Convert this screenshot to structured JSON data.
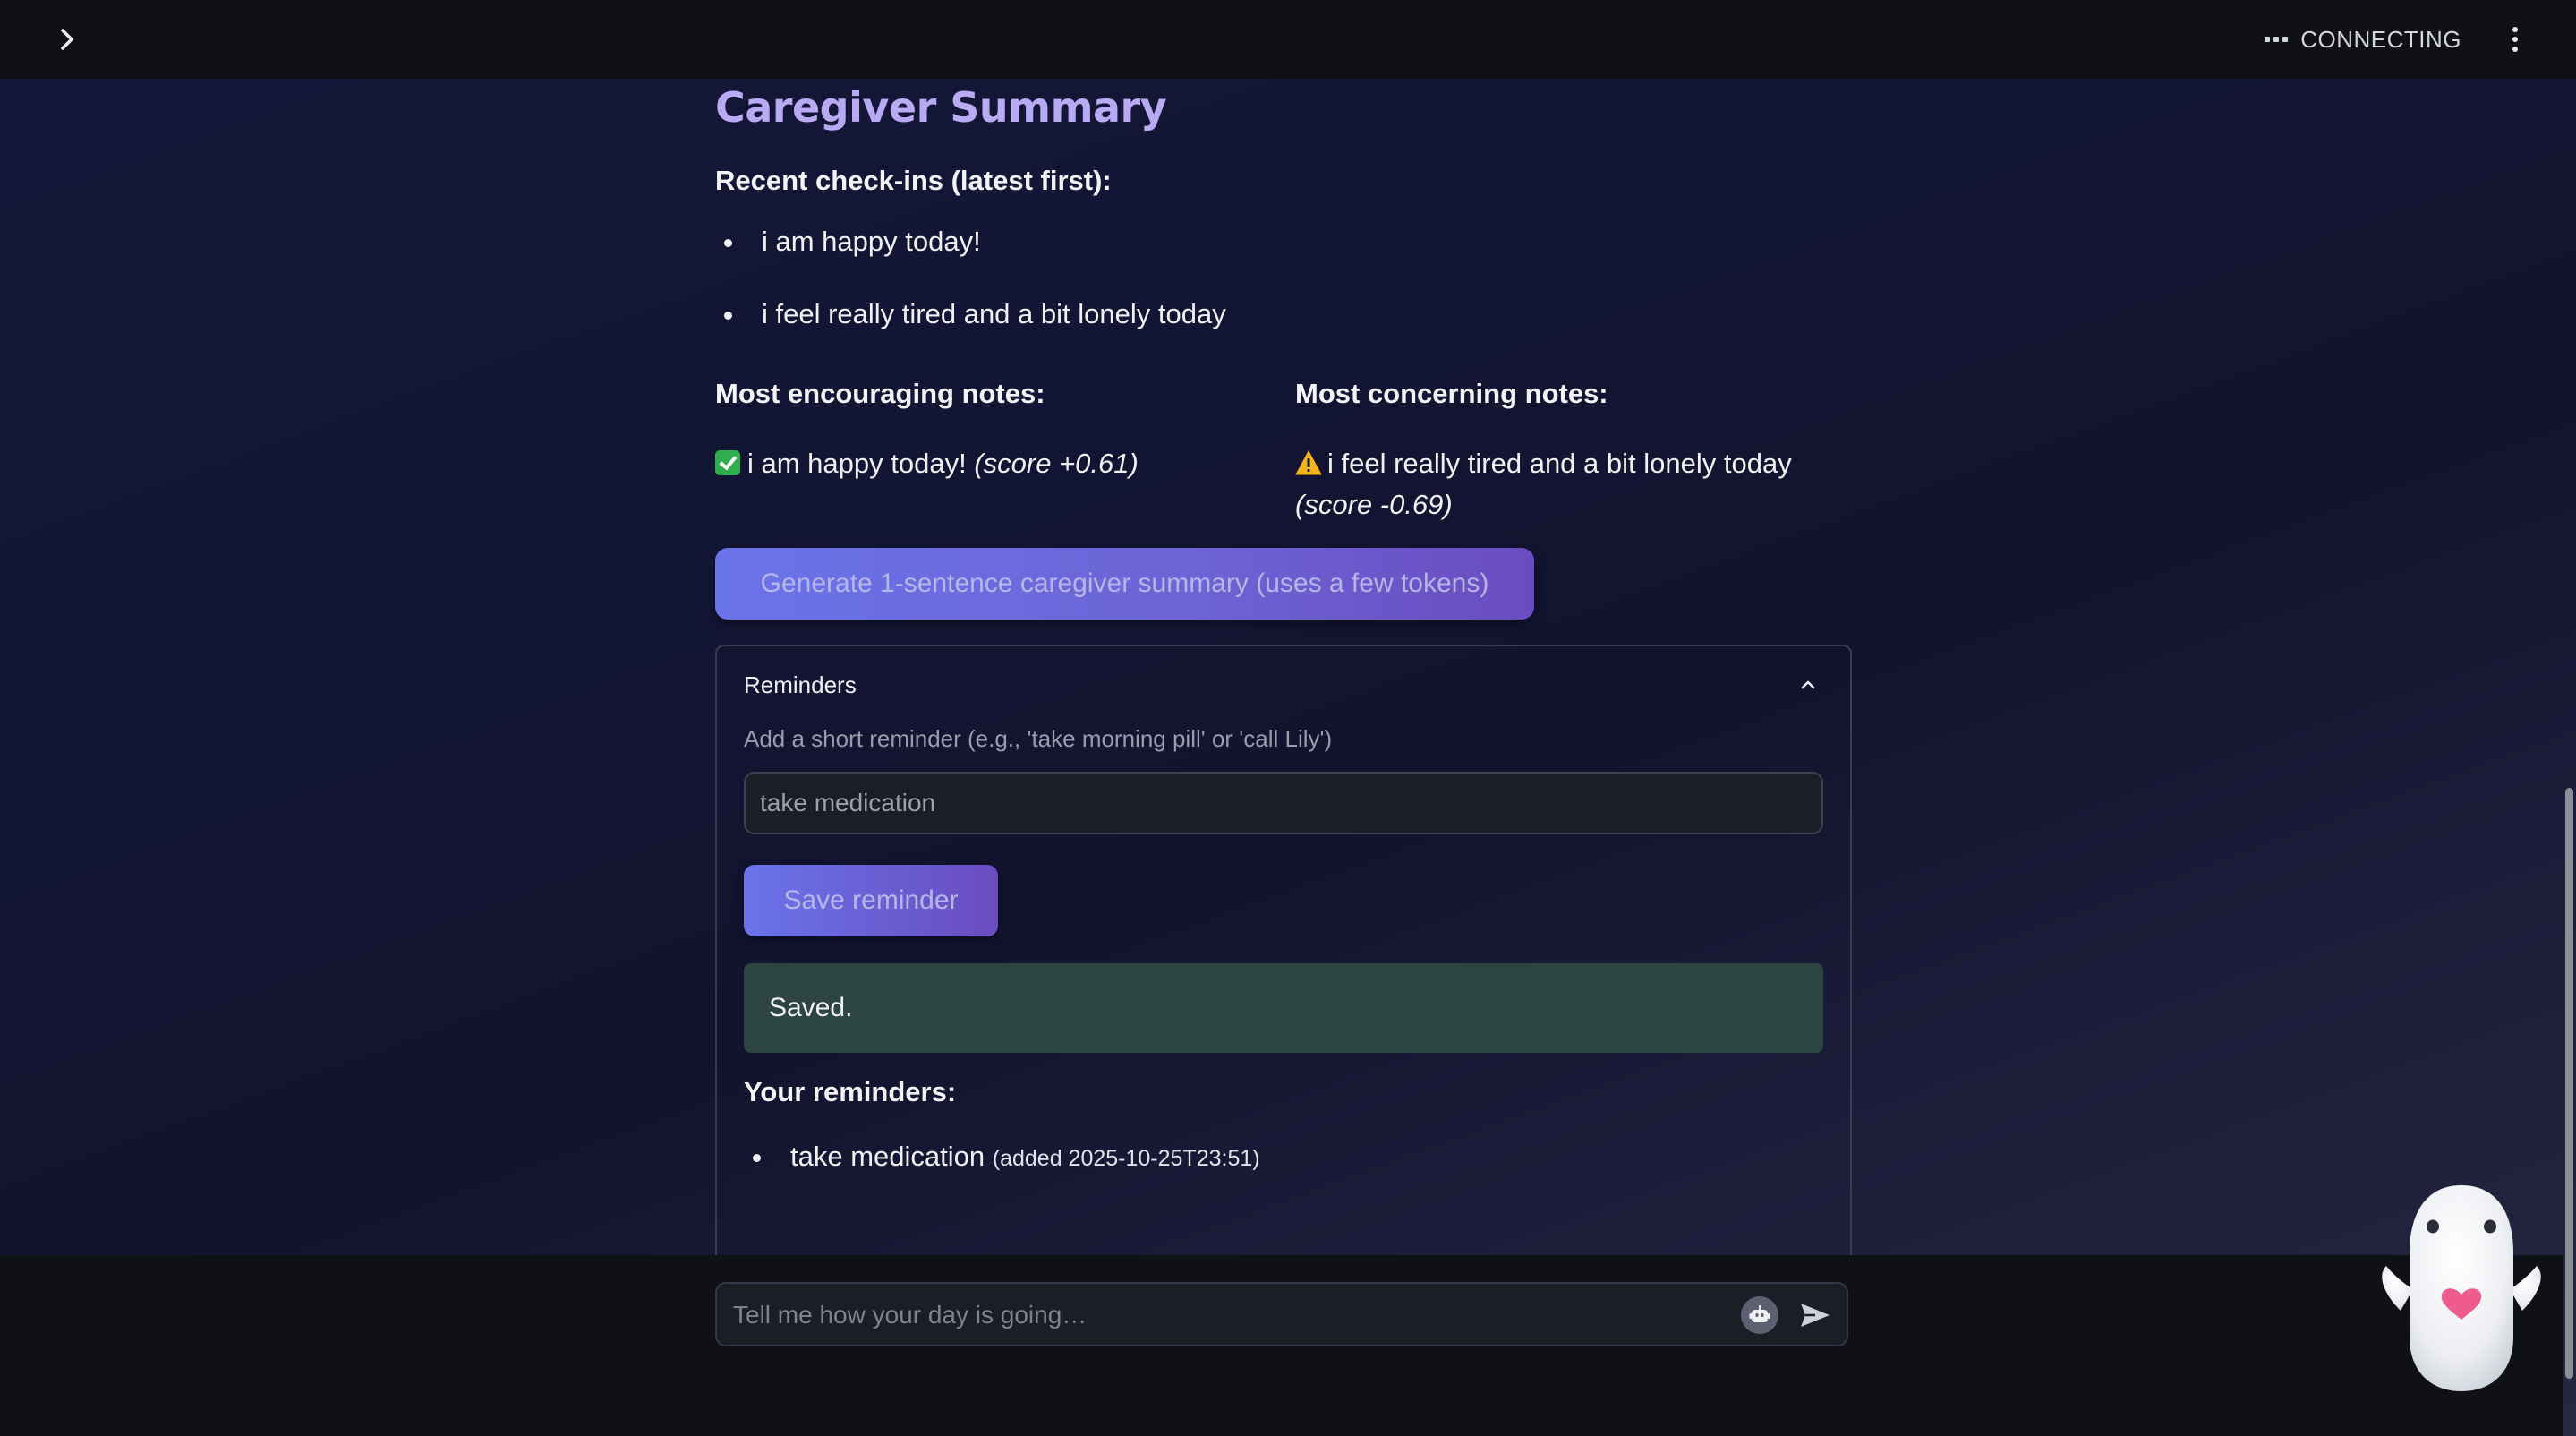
{
  "header": {
    "status": "CONNECTING"
  },
  "summary": {
    "title": "Caregiver Summary",
    "recent_heading": "Recent check-ins (latest first):",
    "recent_checkins": [
      "i am happy today!",
      "i feel really tired and a bit lonely today"
    ],
    "encouraging_heading": "Most encouraging notes:",
    "encouraging_text": "i am happy today!",
    "encouraging_score": "(score +0.61)",
    "concerning_heading": "Most concerning notes:",
    "concerning_text": "i feel really tired and a bit lonely today",
    "concerning_score": "(score -0.69)",
    "generate_button": "Generate 1-sentence caregiver summary (uses a few tokens)"
  },
  "reminders": {
    "header": "Reminders",
    "input_label": "Add a short reminder (e.g., 'take morning pill' or 'call Lily')",
    "input_value": "take medication",
    "save_button": "Save reminder",
    "saved_message": "Saved.",
    "list_heading": "Your reminders:",
    "items": [
      {
        "text": "take medication",
        "added": "(added 2025-10-25T23:51)"
      }
    ]
  },
  "chat": {
    "placeholder": "Tell me how your day is going…"
  },
  "icons": {
    "sidebar_toggle": "chevron-right-icon",
    "status": "ellipsis-icon",
    "menu": "kebab-menu-icon",
    "collapse": "chevron-up-icon",
    "bot": "robot-icon",
    "send": "send-icon",
    "mascot": "ghost-mascot-icon"
  },
  "colors": {
    "title": "#b9aaf4",
    "button_gradient_start": "#6a74ea",
    "button_gradient_end": "#6a4cc0",
    "success_bg": "#2c4541",
    "heart": "#ef5b8a"
  }
}
